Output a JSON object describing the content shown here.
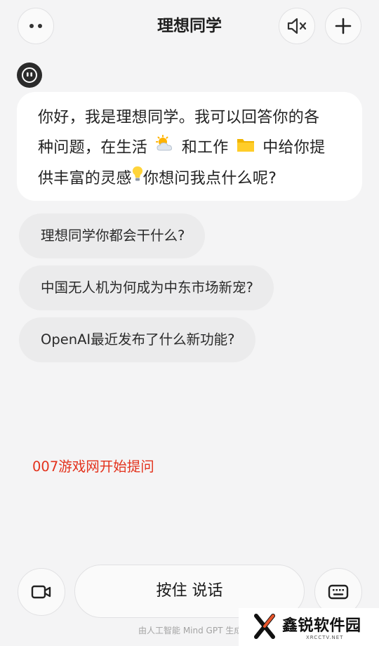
{
  "header": {
    "title": "理想同学",
    "menu_icon": "more-dots-icon",
    "mute_icon": "speaker-muted-icon",
    "new_icon": "plus-icon"
  },
  "assistant": {
    "avatar_icon": "robot-face-icon",
    "greeting": {
      "line1": "你好，我是理想同学。我可以回答你的各",
      "line2_a": "种问题，在生活",
      "line2_b": "和工作",
      "line2_c": "中给你提",
      "line3_a": "供丰富的灵感",
      "line3_b": "你想问我点什么呢?",
      "emoji_life": "sun-behind-cloud-icon",
      "emoji_work": "folder-icon",
      "emoji_idea": "light-bulb-icon"
    }
  },
  "suggestions": [
    "理想同学你都会干什么?",
    "中国无人机为何成为中东市场新宠?",
    "OpenAI最近发布了什么新功能?"
  ],
  "overlay_text": "007游戏网开始提问",
  "bottom_bar": {
    "video_icon": "video-camera-icon",
    "talk_label": "按住 说话",
    "keyboard_icon": "keyboard-icon"
  },
  "footer_note": "由人工智能 Mind GPT 生成",
  "brand": {
    "name": "鑫锐软件园",
    "sub": "XRCCTV.NET"
  },
  "colors": {
    "background": "#f4f4f5",
    "bubble": "#ffffff",
    "chip": "#ebebec",
    "overlay_red": "#e3321c"
  }
}
